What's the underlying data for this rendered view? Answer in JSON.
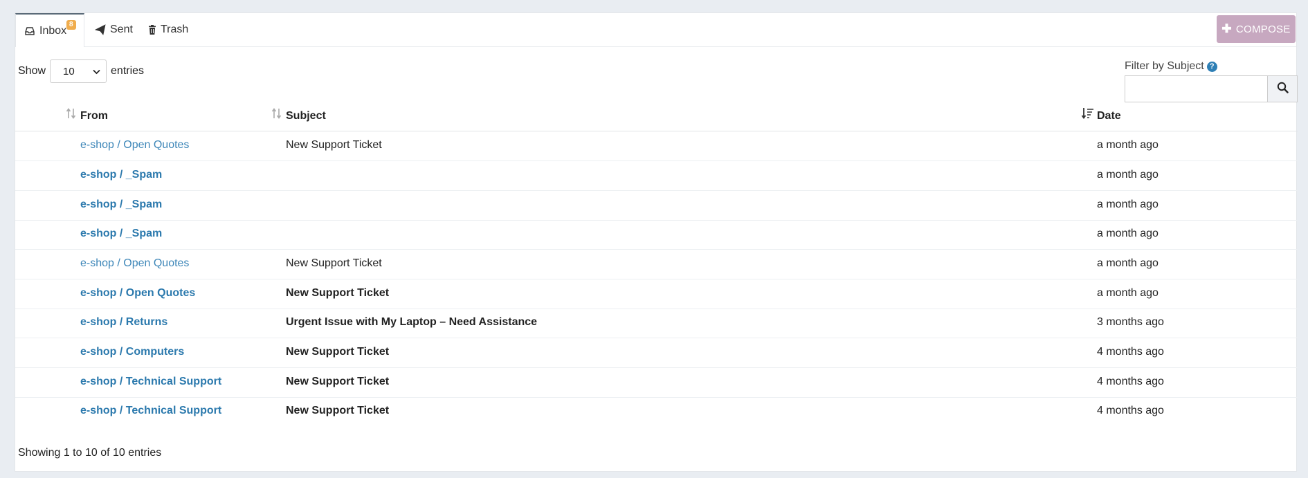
{
  "tabs": [
    {
      "label": "Inbox",
      "icon": "inbox-icon",
      "badge": "8",
      "active": true
    },
    {
      "label": "Sent",
      "icon": "paper-plane-icon"
    },
    {
      "label": "Trash",
      "icon": "trash-icon"
    }
  ],
  "compose_label": "COMPOSE",
  "length_menu": {
    "show": "Show",
    "value": "10",
    "entries": "entries"
  },
  "filter": {
    "label": "Filter by Subject",
    "value": ""
  },
  "columns": {
    "from": "From",
    "subject": "Subject",
    "date": "Date"
  },
  "rows": [
    {
      "from": "e-shop / Open Quotes",
      "subject": "New Support Ticket",
      "date": "a month ago",
      "unread": false
    },
    {
      "from": "e-shop / _Spam",
      "subject": "",
      "date": "a month ago",
      "unread": true
    },
    {
      "from": "e-shop / _Spam",
      "subject": "",
      "date": "a month ago",
      "unread": true
    },
    {
      "from": "e-shop / _Spam",
      "subject": "",
      "date": "a month ago",
      "unread": true
    },
    {
      "from": "e-shop / Open Quotes",
      "subject": "New Support Ticket",
      "date": "a month ago",
      "unread": false
    },
    {
      "from": "e-shop / Open Quotes",
      "subject": "New Support Ticket",
      "date": "a month ago",
      "unread": true
    },
    {
      "from": "e-shop / Returns",
      "subject": "Urgent Issue with My Laptop – Need Assistance",
      "date": "3 months ago",
      "unread": true
    },
    {
      "from": "e-shop / Computers",
      "subject": "New Support Ticket",
      "date": "4 months ago",
      "unread": true
    },
    {
      "from": "e-shop / Technical Support",
      "subject": "New Support Ticket",
      "date": "4 months ago",
      "unread": true
    },
    {
      "from": "e-shop / Technical Support",
      "subject": "New Support Ticket",
      "date": "4 months ago",
      "unread": true
    }
  ],
  "info": "Showing 1 to 10 of 10 entries",
  "colors": {
    "accent": "#2b79ad",
    "compose": "#c7a8c0",
    "badge": "#f0ad4e"
  }
}
